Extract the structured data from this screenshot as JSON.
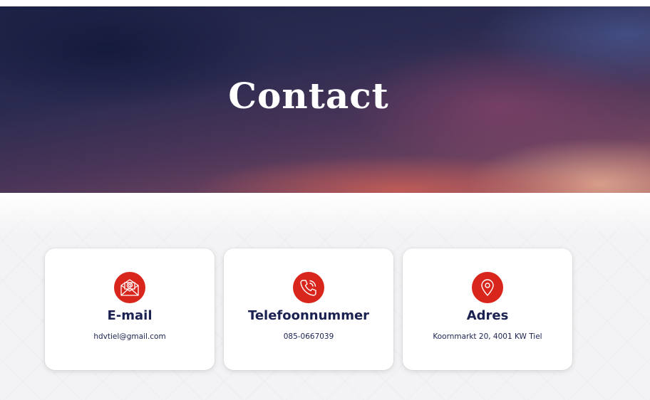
{
  "hero": {
    "title": "Contact"
  },
  "cards": [
    {
      "icon": "envelope-at-icon",
      "title": "E-mail",
      "value": "hdvtiel@gmail.com"
    },
    {
      "icon": "phone-ringing-icon",
      "title": "Telefoonnummer",
      "value": "085-0667039"
    },
    {
      "icon": "map-pin-icon",
      "title": "Adres",
      "value": "Koornmarkt 20, 4001 KW Tiel"
    }
  ],
  "colors": {
    "accent": "#d9261c",
    "heading": "#1b2150",
    "card_bg": "#ffffff"
  }
}
